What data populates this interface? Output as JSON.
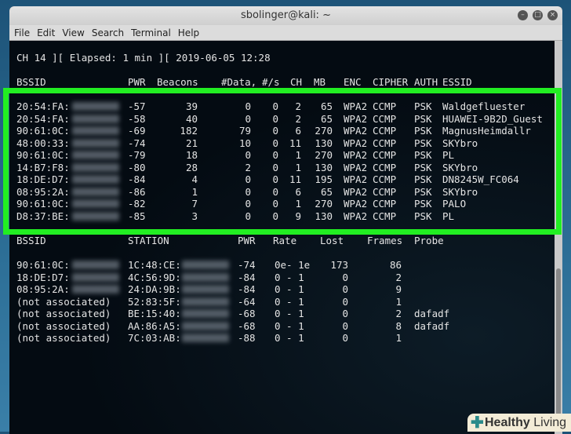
{
  "window": {
    "title": "sbolinger@kali: ~",
    "menu": [
      "File",
      "Edit",
      "View",
      "Search",
      "Terminal",
      "Help"
    ]
  },
  "status_line": "CH 14 ][ Elapsed: 1 min ][ 2019-06-05 12:28",
  "ap_table": {
    "headers": [
      "BSSID",
      "PWR",
      "Beacons",
      "#Data,",
      "#/s",
      "CH",
      "MB",
      "ENC",
      "CIPHER",
      "AUTH",
      "ESSID"
    ],
    "rows": [
      [
        "20:54:FA:",
        "-57",
        "39",
        "0",
        "0",
        "2",
        "65",
        "WPA2",
        "CCMP",
        "PSK",
        "Waldgefluester"
      ],
      [
        "20:54:FA:",
        "-58",
        "40",
        "0",
        "0",
        "2",
        "65",
        "WPA2",
        "CCMP",
        "PSK",
        "HUAWEI-9B2D_Guest"
      ],
      [
        "90:61:0C:",
        "-69",
        "182",
        "79",
        "0",
        "6",
        "270",
        "WPA2",
        "CCMP",
        "PSK",
        "MagnusHeimdallr"
      ],
      [
        "48:00:33:",
        "-74",
        "21",
        "10",
        "0",
        "11",
        "130",
        "WPA2",
        "CCMP",
        "PSK",
        "SKYbro"
      ],
      [
        "90:61:0C:",
        "-79",
        "18",
        "0",
        "0",
        "1",
        "270",
        "WPA2",
        "CCMP",
        "PSK",
        "PL"
      ],
      [
        "14:B7:F8:",
        "-80",
        "28",
        "2",
        "0",
        "1",
        "130",
        "WPA2",
        "CCMP",
        "PSK",
        "SKYbro"
      ],
      [
        "18:DE:D7:",
        "-84",
        "4",
        "0",
        "0",
        "11",
        "195",
        "WPA2",
        "CCMP",
        "PSK",
        "DN8245W_FC064"
      ],
      [
        "08:95:2A:",
        "-86",
        "1",
        "0",
        "0",
        "6",
        "65",
        "WPA2",
        "CCMP",
        "PSK",
        "SKYbro"
      ],
      [
        "90:61:0C:",
        "-82",
        "7",
        "0",
        "0",
        "1",
        "270",
        "WPA2",
        "CCMP",
        "PSK",
        "PALO"
      ],
      [
        "D8:37:BE:",
        "-85",
        "3",
        "0",
        "0",
        "9",
        "130",
        "WPA2",
        "CCMP",
        "PSK",
        "PL"
      ]
    ]
  },
  "station_table": {
    "headers": [
      "BSSID",
      "STATION",
      "PWR",
      "Rate",
      "Lost",
      "Frames",
      "Probe"
    ],
    "rows": [
      [
        "90:61:0C:",
        "1C:48:CE:",
        "-74",
        "0e- 1e",
        "173",
        "86",
        ""
      ],
      [
        "18:DE:D7:",
        "4C:56:9D:",
        "-84",
        "0 - 1",
        "0",
        "2",
        ""
      ],
      [
        "08:95:2A:",
        "24:DA:9B:",
        "-84",
        "0 - 1",
        "0",
        "9",
        ""
      ],
      [
        "(not associated)",
        "52:83:5F:",
        "-64",
        "0 - 1",
        "0",
        "1",
        ""
      ],
      [
        "(not associated)",
        "BE:15:40:",
        "-68",
        "0 - 1",
        "0",
        "2",
        "dafadf"
      ],
      [
        "(not associated)",
        "AA:86:A5:",
        "-68",
        "0 - 1",
        "0",
        "8",
        "dafadf"
      ],
      [
        "(not associated)",
        "7C:03:AB:",
        "-88",
        "0 - 1",
        "0",
        "1",
        ""
      ]
    ]
  },
  "watermark": {
    "brand": "Healthy",
    "suffix": "Living"
  },
  "colors": {
    "highlight": "#22ee22",
    "terminal_bg": "#030a10"
  }
}
